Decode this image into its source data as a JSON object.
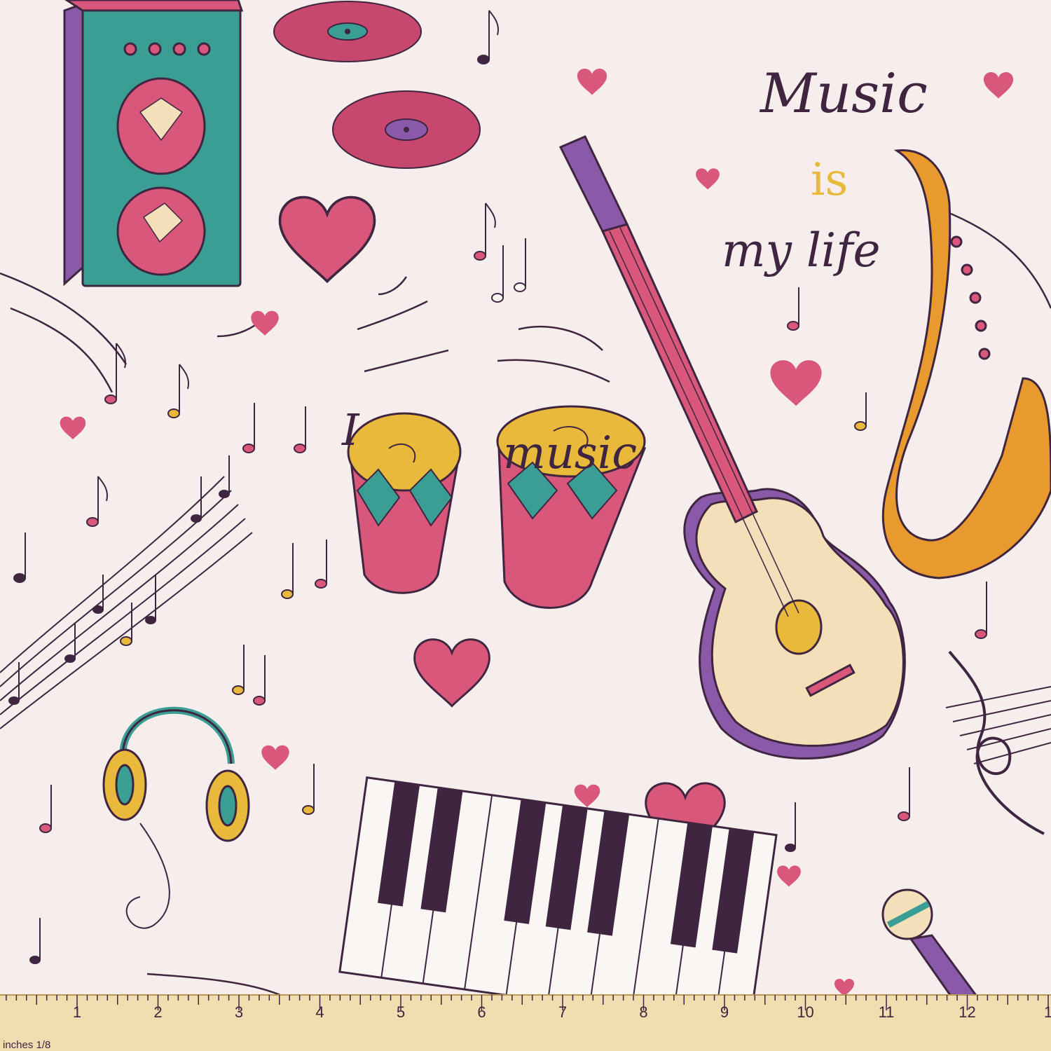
{
  "phrases": {
    "music": "Music",
    "is": "is",
    "my_life": "my life",
    "i": "I",
    "music_lower": "music"
  },
  "ruler": {
    "unit_label": "inches 1/8",
    "numbers": [
      "1",
      "2",
      "3",
      "4",
      "5",
      "6",
      "7",
      "8",
      "9",
      "10",
      "11",
      "12",
      "1"
    ]
  },
  "colors": {
    "background": "#f6eeec",
    "ink": "#3f2540",
    "pink": "#d9577a",
    "teal": "#3a9e95",
    "purple": "#8a5aa8",
    "yellow": "#e8b93a",
    "orange": "#e89a2e",
    "cream": "#f3dfb8",
    "ruler": "#f2ddb0"
  }
}
